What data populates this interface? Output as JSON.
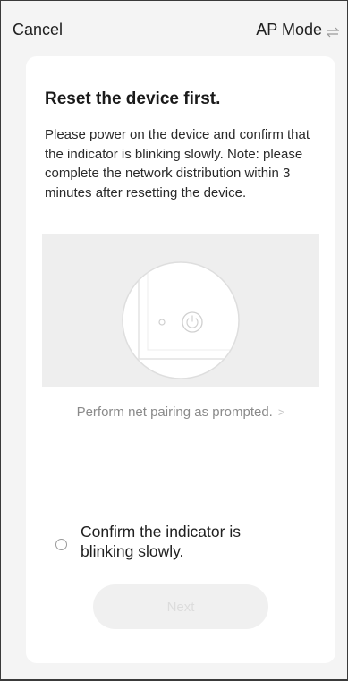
{
  "header": {
    "cancel_label": "Cancel",
    "mode_label": "AP Mode",
    "mode_icon": "swap-arrows-icon"
  },
  "card": {
    "title": "Reset the device first.",
    "description": "Please power on the device and confirm that the indicator is blinking slowly. Note: please complete the network distribution within 3 minutes after resetting the device.",
    "illustration_icon": "power-icon",
    "prompt_label": "Perform net pairing as prompted.",
    "prompt_icon": "chevron-right-icon",
    "confirm_label": "Confirm the indicator is blinking slowly.",
    "confirm_checked": false,
    "next_label": "Next",
    "next_enabled": false
  },
  "colors": {
    "background": "#f4f4f4",
    "card": "#ffffff",
    "text_primary": "#1a1a1a",
    "text_secondary": "#8a8a8a",
    "button_disabled_bg": "#f0f0f0",
    "button_disabled_text": "#dcdcdc"
  }
}
